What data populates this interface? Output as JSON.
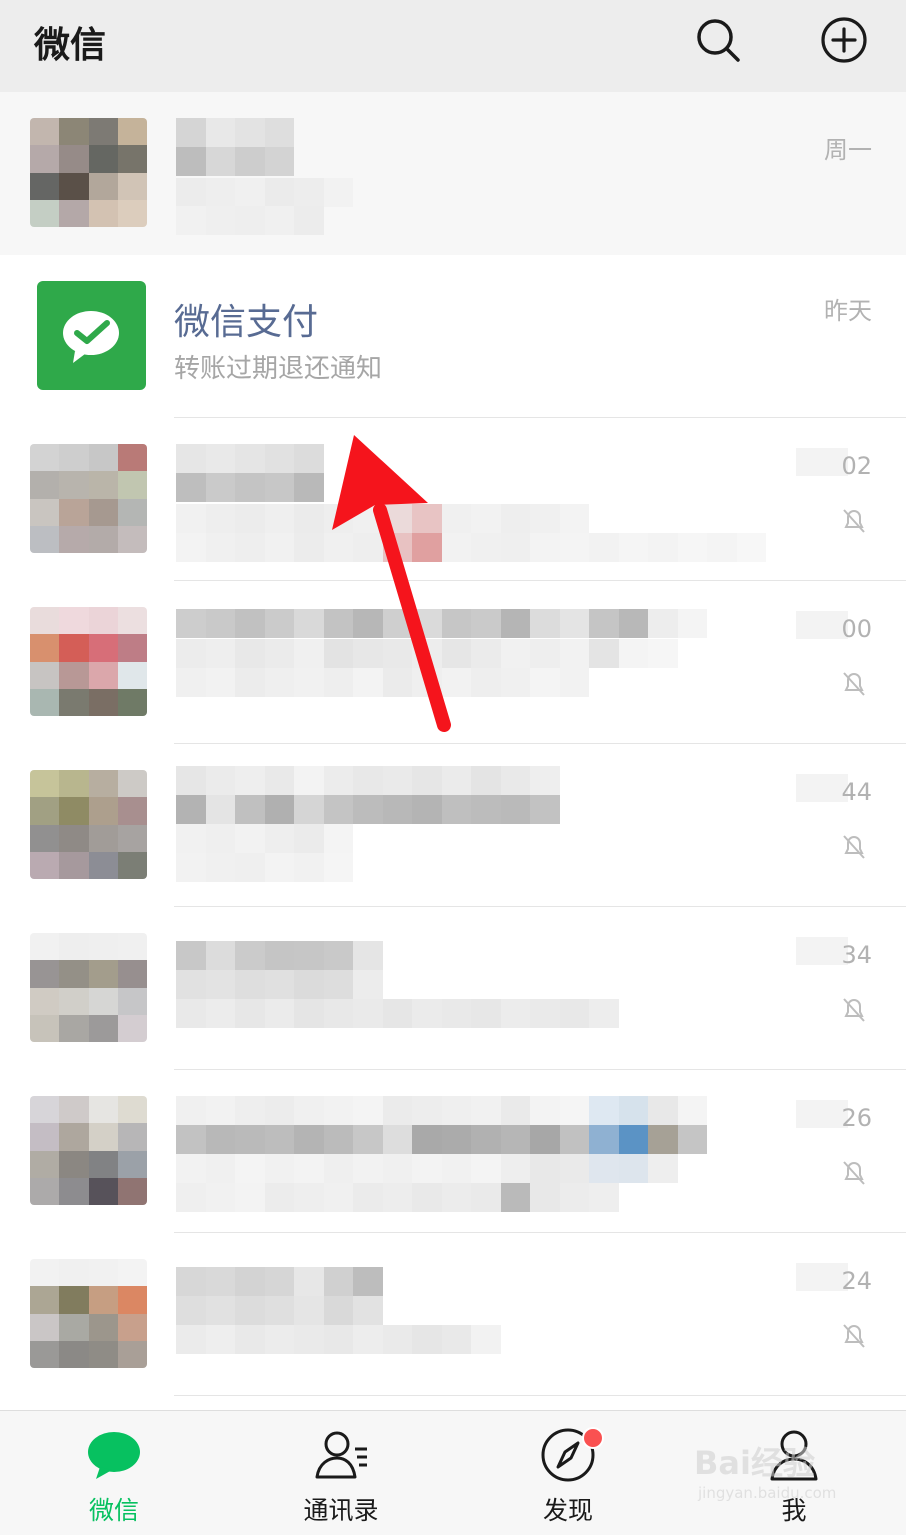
{
  "header": {
    "title": "微信",
    "search_icon": "search-icon",
    "add_icon": "plus-circle-icon"
  },
  "chats": [
    {
      "name": "",
      "preview": "",
      "time": "周一",
      "pinned": true,
      "muted": false,
      "redacted": true
    },
    {
      "name": "微信支付",
      "preview": "转账过期退还通知",
      "time": "昨天",
      "pinned": false,
      "muted": false,
      "redacted": false
    },
    {
      "name": "",
      "preview": "",
      "time": "02",
      "pinned": false,
      "muted": true,
      "redacted": true
    },
    {
      "name": "",
      "preview": "",
      "time": "00",
      "pinned": false,
      "muted": true,
      "redacted": true
    },
    {
      "name": "",
      "preview": "",
      "time": "44",
      "pinned": false,
      "muted": true,
      "redacted": true
    },
    {
      "name": "",
      "preview": "",
      "time": "34",
      "pinned": false,
      "muted": true,
      "redacted": true
    },
    {
      "name": "",
      "preview": "",
      "time": "26",
      "pinned": false,
      "muted": true,
      "redacted": true
    },
    {
      "name": "",
      "preview": "",
      "time": "24",
      "pinned": false,
      "muted": true,
      "redacted": true
    }
  ],
  "tabbar": [
    {
      "label": "微信",
      "icon": "chat-bubble-icon",
      "active": true,
      "badge": false
    },
    {
      "label": "通讯录",
      "icon": "contacts-icon",
      "active": false,
      "badge": false
    },
    {
      "label": "发现",
      "icon": "compass-icon",
      "active": false,
      "badge": true
    },
    {
      "label": "我",
      "icon": "person-icon",
      "active": false,
      "badge": false
    }
  ],
  "annotation": {
    "arrow_color": "#f5141c",
    "points_to": "微信支付"
  },
  "watermark": {
    "brand": "Bai经验",
    "url": "jingyan.baidu.com"
  },
  "colors": {
    "accent": "#07c160",
    "pay_green": "#2fa94a",
    "pay_name": "#586b93",
    "badge": "#fa5151"
  }
}
